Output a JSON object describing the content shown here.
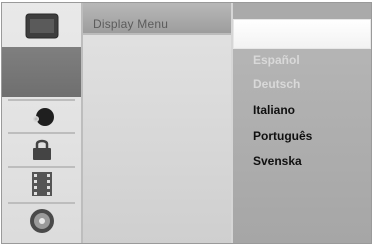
{
  "menu": {
    "title": "Display Menu",
    "sidebar_icons": [
      {
        "name": "tv-icon"
      },
      {
        "name": "blank-slot"
      },
      {
        "name": "audio-icon"
      },
      {
        "name": "lock-icon"
      },
      {
        "name": "film-icon"
      },
      {
        "name": "disc-icon"
      }
    ],
    "languages": [
      {
        "label": "Español",
        "state": "dim"
      },
      {
        "label": "Deutsch",
        "state": "dim"
      },
      {
        "label": "Italiano",
        "state": "bright"
      },
      {
        "label": "Português",
        "state": "bright"
      },
      {
        "label": "Svenska",
        "state": "bright"
      }
    ]
  }
}
